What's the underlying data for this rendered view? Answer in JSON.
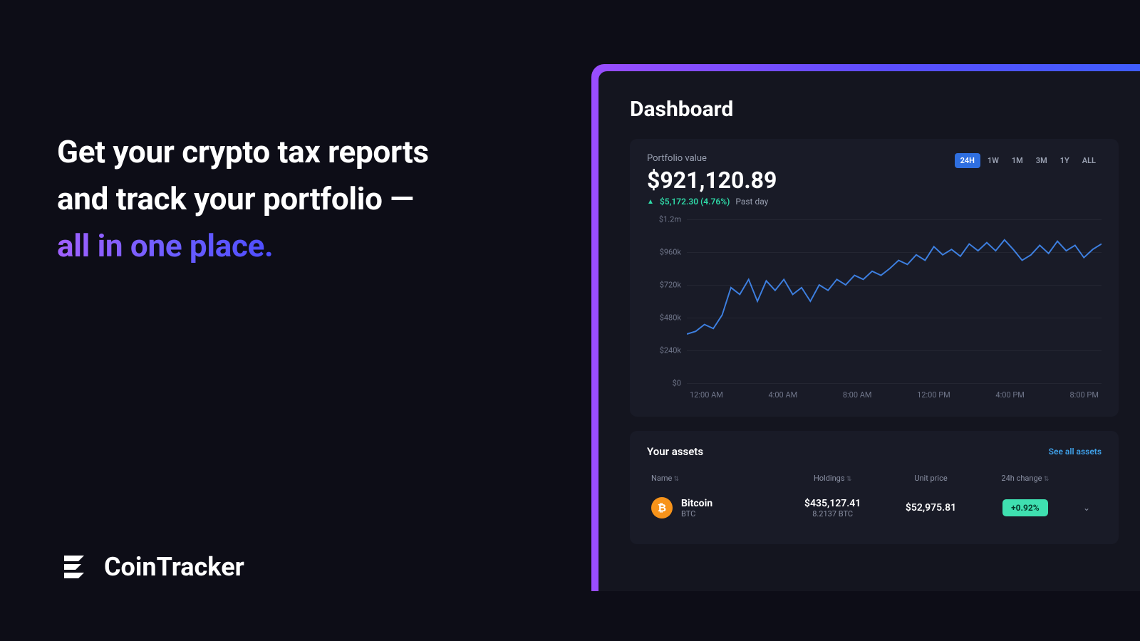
{
  "hero": {
    "line1": "Get your crypto tax reports",
    "line2": "and track your portfolio —",
    "accent": "all in one place."
  },
  "brand": {
    "name": "CoinTracker"
  },
  "dashboard": {
    "title": "Dashboard",
    "portfolio": {
      "label": "Portfolio value",
      "value": "$921,120.89",
      "change_value": "$5,172.30 (4.76%)",
      "change_period": "Past day",
      "range_tabs": [
        "24H",
        "1W",
        "1M",
        "3M",
        "1Y",
        "ALL"
      ],
      "range_active": "24H"
    },
    "assets": {
      "title": "Your assets",
      "see_all": "See all assets",
      "columns": {
        "name": "Name",
        "holdings": "Holdings",
        "unit_price": "Unit price",
        "change": "24h change"
      },
      "rows": [
        {
          "name": "Bitcoin",
          "symbol": "BTC",
          "holdings_usd": "$435,127.41",
          "holdings_qty": "8.2137 BTC",
          "unit_price": "$52,975.81",
          "change": "+0.92%"
        }
      ]
    }
  },
  "chart_data": {
    "type": "line",
    "title": "Portfolio value",
    "xlabel": "",
    "ylabel": "",
    "ylim": [
      0,
      1200000
    ],
    "y_ticks": [
      "$0",
      "$240k",
      "$480k",
      "$720k",
      "$960k",
      "$1.2m"
    ],
    "x_ticks": [
      "12:00 AM",
      "4:00 AM",
      "8:00 AM",
      "12:00 PM",
      "4:00 PM",
      "8:00 PM"
    ],
    "series": [
      {
        "name": "Portfolio value",
        "color": "#3d7fe0",
        "x": [
          0,
          1,
          2,
          3,
          4,
          5,
          6,
          7,
          8,
          9,
          10,
          11,
          12,
          13,
          14,
          15,
          16,
          17,
          18,
          19,
          20,
          21,
          22,
          23,
          24,
          25,
          26,
          27,
          28,
          29,
          30,
          31,
          32,
          33,
          34,
          35,
          36,
          37,
          38,
          39,
          40,
          41,
          42,
          43,
          44,
          45,
          46,
          47
        ],
        "values": [
          360000,
          380000,
          430000,
          400000,
          500000,
          700000,
          650000,
          760000,
          600000,
          750000,
          680000,
          760000,
          650000,
          700000,
          600000,
          720000,
          680000,
          760000,
          720000,
          790000,
          760000,
          820000,
          790000,
          840000,
          900000,
          870000,
          940000,
          900000,
          1000000,
          940000,
          980000,
          930000,
          1020000,
          970000,
          1030000,
          970000,
          1050000,
          980000,
          900000,
          940000,
          1010000,
          950000,
          1040000,
          970000,
          1010000,
          920000,
          980000,
          1020000
        ]
      }
    ]
  }
}
